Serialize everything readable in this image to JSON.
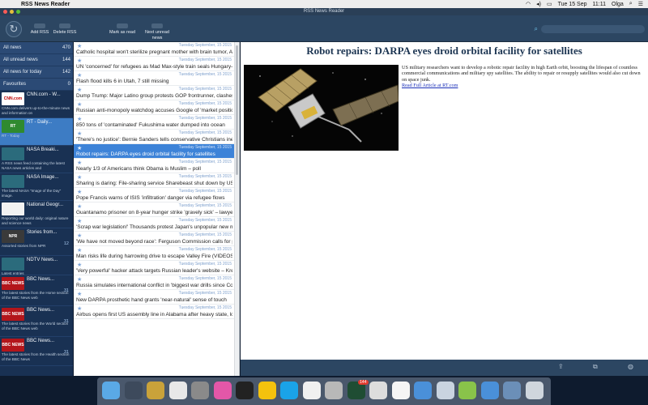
{
  "menubar": {
    "app_name": "RSS News Reader",
    "status": {
      "date": "Tue 15 Sep",
      "time": "11:11",
      "user": "Olga"
    }
  },
  "window": {
    "title": "RSS News Reader"
  },
  "toolbar": {
    "add_rss": "Add RSS",
    "delete_rss": "Delete RSS",
    "mark_as_read": "Mark as read",
    "next_unread": "Next unread news"
  },
  "sidebar": {
    "categories": [
      {
        "label": "All news",
        "count": "470"
      },
      {
        "label": "All unread news",
        "count": "144"
      },
      {
        "label": "All news for today",
        "count": "142"
      },
      {
        "label": "Favourites",
        "count": "0"
      }
    ],
    "feeds": [
      {
        "name": "CNN.com - W...",
        "logo": "CNN.com",
        "logo_color": "#ffffff",
        "logo_text": "#c00000",
        "desc": "CNN.com delivers up-to-the-minute news and information on",
        "count": ""
      },
      {
        "name": "RT - Daily...",
        "logo": "RT",
        "logo_color": "#2f8a2f",
        "logo_text": "#ffffff",
        "desc": "RT - Today",
        "count": "",
        "selected": true
      },
      {
        "name": "NASA Breaki...",
        "logo": "",
        "logo_color": "#2b6b7c",
        "logo_text": "#ffffff",
        "desc": "A RSS news feed containing the latest NASA news articles and",
        "count": ""
      },
      {
        "name": "NASA Image...",
        "logo": "",
        "logo_color": "#2b6b7c",
        "logo_text": "#ffffff",
        "desc": "The latest NASA \"Image of the Day\" image.",
        "count": ""
      },
      {
        "name": "National Geogr...",
        "logo": "",
        "logo_color": "#f2f2f2",
        "logo_text": "#333333",
        "desc": "Reporting our world daily: original nature and science news",
        "count": ""
      },
      {
        "name": "Stories from...",
        "logo": "NPR",
        "logo_color": "#3a3a3a",
        "logo_text": "#ffffff",
        "desc": "Assorted stories from NPR",
        "count": "12"
      },
      {
        "name": "NDTV News...",
        "logo": "",
        "logo_color": "#2b6b7c",
        "logo_text": "#ffffff",
        "desc": "Latest entries",
        "count": ""
      },
      {
        "name": "BBC News...",
        "logo": "BBC NEWS",
        "logo_color": "#b3161b",
        "logo_text": "#ffffff",
        "desc": "The latest stories from the Home section of the BBC News web",
        "count": "31"
      },
      {
        "name": "BBC News...",
        "logo": "BBC NEWS",
        "logo_color": "#b3161b",
        "logo_text": "#ffffff",
        "desc": "The latest stories from the World section of the BBC News web",
        "count": "31"
      },
      {
        "name": "BBC News...",
        "logo": "BBC NEWS",
        "logo_color": "#b3161b",
        "logo_text": "#ffffff",
        "desc": "The latest stories from the Health section of the BBC News",
        "count": "31"
      }
    ]
  },
  "articles": [
    {
      "date": "Tuesday September, 15 2015",
      "title": "Catholic hospital won't sterilize pregnant mother with brain tumor, AC"
    },
    {
      "date": "Tuesday September, 15 2015",
      "title": "UN 'concerned' for refugees as Mad Max-style train seals Hungary-Se"
    },
    {
      "date": "Tuesday September, 15 2015",
      "title": "Flash flood kills 6 in Utah, 7 still missing"
    },
    {
      "date": "Tuesday September, 15 2015",
      "title": "Dump Trump: Major Latino group protests GOP frontrunner, clashes w"
    },
    {
      "date": "Tuesday September, 15 2015",
      "title": "Russian anti-monopoly watchdog accuses Google of 'market position"
    },
    {
      "date": "Tuesday September, 15 2015",
      "title": "850 tons of 'contaminated' Fukushima water dumped into ocean"
    },
    {
      "date": "Tuesday September, 15 2015",
      "title": "'There's no justice': Bernie Sanders tells conservative Christians inequ"
    },
    {
      "date": "Tuesday September, 15 2015",
      "title": "Robot repairs: DARPA eyes droid orbital facility for satellites",
      "selected": true
    },
    {
      "date": "Tuesday September, 15 2015",
      "title": "Nearly 1/3 of Americans think Obama is Muslim – poll"
    },
    {
      "date": "Tuesday September, 15 2015",
      "title": "Sharing is daring: File-sharing service Sharebeast shut down by US D"
    },
    {
      "date": "Tuesday September, 15 2015",
      "title": "Pope Francis warns of ISIS 'infiltration' danger via refugee flows"
    },
    {
      "date": "Tuesday September, 15 2015",
      "title": "Guantanamo prisoner on 8-year hunger strike 'gravely sick' – lawyers"
    },
    {
      "date": "Tuesday September, 15 2015",
      "title": "'Scrap war legislation!' Thousands protest Japan's unpopular new mil"
    },
    {
      "date": "Tuesday September, 15 2015",
      "title": "'We have not moved beyond race': Ferguson Commission calls for po"
    },
    {
      "date": "Tuesday September, 15 2015",
      "title": "Man risks life during harrowing drive to escape Valley Fire (VIDEOS)"
    },
    {
      "date": "Tuesday September, 15 2015",
      "title": "'Very powerful' hacker attack targets Russian leader's website – Krem"
    },
    {
      "date": "Tuesday September, 15 2015",
      "title": "Russia simulates international conflict in 'biggest war drills since Cold"
    },
    {
      "date": "Tuesday September, 15 2015",
      "title": "New DARPA prosthetic hand grants 'near-natural' sense of touch"
    },
    {
      "date": "Tuesday September, 15 2015",
      "title": "Airbus opens first US assembly line in Alabama after heavy state, loca"
    }
  ],
  "article": {
    "title": "Robot repairs: DARPA eyes droid orbital facility for satellites",
    "body": "US military researchers want to develop a robotic repair facility in high Earth orbit, boosting the lifespan of countless commercial communications and military spy satellites. The ability to repair or resupply satellites would also cut down on space junk.",
    "link": "Read Full Article at RT.com"
  },
  "dock": {
    "badge": "144",
    "icons": [
      "finder-icon",
      "launchpad-icon",
      "mosaic-icon",
      "itunes-icon",
      "system-preferences-icon",
      "pink-app-icon",
      "console-icon",
      "chrome-icon",
      "skype-icon",
      "text-edit-icon",
      "archive-icon",
      "rss-reader-icon",
      "preview-icon",
      "paper-icon",
      "folder-icon",
      "preview2-icon",
      "android-icon",
      "folder2-icon",
      "rss-app-icon",
      "trash-icon"
    ]
  }
}
